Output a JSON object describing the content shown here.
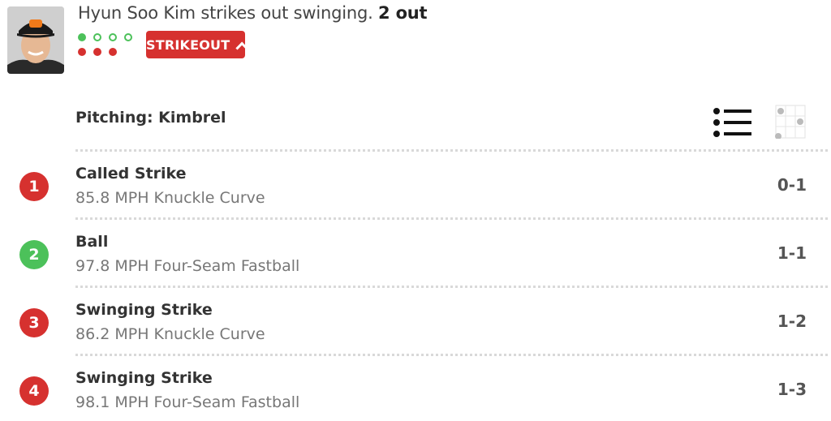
{
  "play": {
    "headline": "Hyun Soo Kim strikes out swinging.",
    "outs_label": "2 out",
    "result_badge": "STRIKEOUT",
    "balls": 1,
    "strikes": 3
  },
  "pitcher": {
    "label": "Pitching: Kimbrel"
  },
  "colors": {
    "strike": "#d6312f",
    "ball": "#4cc15a",
    "separator": "#d9d9d9"
  },
  "icons": {
    "list_view": "list-icon",
    "zone_view": "strike-zone-icon",
    "player": "player-headshot"
  },
  "pitches": [
    {
      "number": "1",
      "result": "Called Strike",
      "description": "85.8 MPH Knuckle Curve",
      "count": "0-1",
      "type": "strike"
    },
    {
      "number": "2",
      "result": "Ball",
      "description": "97.8 MPH Four-Seam Fastball",
      "count": "1-1",
      "type": "ball"
    },
    {
      "number": "3",
      "result": "Swinging Strike",
      "description": "86.2 MPH Knuckle Curve",
      "count": "1-2",
      "type": "strike"
    },
    {
      "number": "4",
      "result": "Swinging Strike",
      "description": "98.1 MPH Four-Seam Fastball",
      "count": "1-3",
      "type": "strike"
    }
  ]
}
